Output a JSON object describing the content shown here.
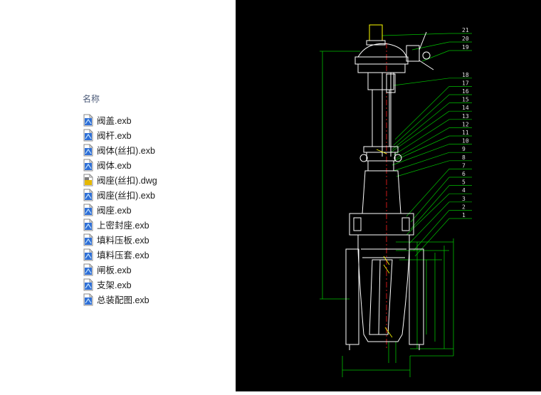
{
  "file_list": {
    "header": "名称",
    "files": [
      {
        "name": "阀盖.exb",
        "icon": "exb-file-icon"
      },
      {
        "name": "阀杆.exb",
        "icon": "exb-file-icon"
      },
      {
        "name": "阀体(丝扣).exb",
        "icon": "exb-file-icon"
      },
      {
        "name": "阀体.exb",
        "icon": "exb-file-icon"
      },
      {
        "name": "阀座(丝扣).dwg",
        "icon": "dwg-file-icon"
      },
      {
        "name": "阀座(丝扣).exb",
        "icon": "exb-file-icon"
      },
      {
        "name": "阀座.exb",
        "icon": "exb-file-icon"
      },
      {
        "name": "上密封座.exb",
        "icon": "exb-file-icon"
      },
      {
        "name": "填料压板.exb",
        "icon": "exb-file-icon"
      },
      {
        "name": "填料压套.exb",
        "icon": "exb-file-icon"
      },
      {
        "name": "闸板.exb",
        "icon": "exb-file-icon"
      },
      {
        "name": "支架.exb",
        "icon": "exb-file-icon"
      },
      {
        "name": "总装配图.exb",
        "icon": "exb-file-icon"
      }
    ]
  },
  "drawing": {
    "background": "#000000",
    "colors": {
      "outline": "#ffffff",
      "dimension": "#00ff00",
      "centerline": "#ff0000",
      "highlight": "#ffff00"
    },
    "part_numbers": [
      "21",
      "20",
      "19",
      "18",
      "17",
      "16",
      "15",
      "14",
      "13",
      "12",
      "11",
      "10",
      "9",
      "8",
      "7",
      "6",
      "5",
      "4",
      "3",
      "2",
      "1"
    ]
  }
}
